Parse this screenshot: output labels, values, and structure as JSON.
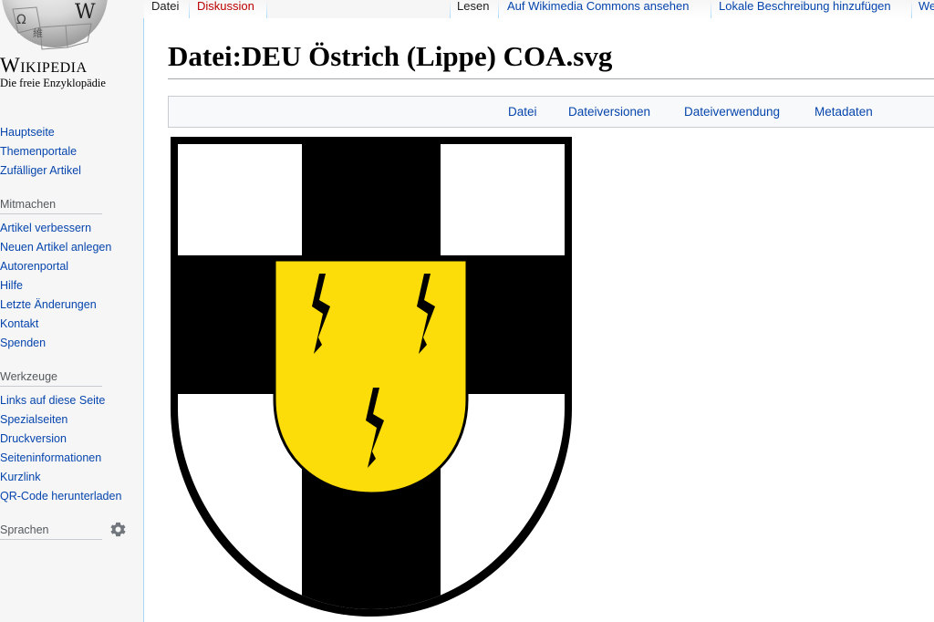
{
  "logo": {
    "wordmark": "Wikipedia",
    "tagline": "Die freie Enzyklopädie",
    "globe_glyphs": [
      "Ω",
      "W",
      "維"
    ]
  },
  "sidebar": {
    "main_links": [
      "Hauptseite",
      "Themenportale",
      "Zufälliger Artikel"
    ],
    "mitmachen": {
      "heading": "Mitmachen",
      "links": [
        "Artikel verbessern",
        "Neuen Artikel anlegen",
        "Autorenportal",
        "Hilfe",
        "Letzte Änderungen",
        "Kontakt",
        "Spenden"
      ]
    },
    "werkzeuge": {
      "heading": "Werkzeuge",
      "links": [
        "Links auf diese Seite",
        "Spezialseiten",
        "Druckversion",
        "Seiteninformationen",
        "Kurzlink",
        "QR-Code herunterladen"
      ]
    },
    "sprachen": {
      "heading": "Sprachen",
      "icon": "gear-icon"
    }
  },
  "tabs": {
    "datei": "Datei",
    "diskussion": "Diskussion",
    "lesen": "Lesen",
    "commons": "Auf Wikimedia Commons ansehen",
    "lokale": "Lokale Beschreibung hinzufügen",
    "more": "We"
  },
  "page": {
    "title": "Datei:DEU Östrich (Lippe) COA.svg"
  },
  "filetoc": [
    "Datei",
    "Dateiversionen",
    "Dateiverwendung",
    "Metadaten"
  ],
  "colors": {
    "link": "#0645ad",
    "redlink": "#ba0000",
    "coa_yellow": "#fcdd09",
    "coa_black": "#000000",
    "coa_white": "#ffffff"
  }
}
